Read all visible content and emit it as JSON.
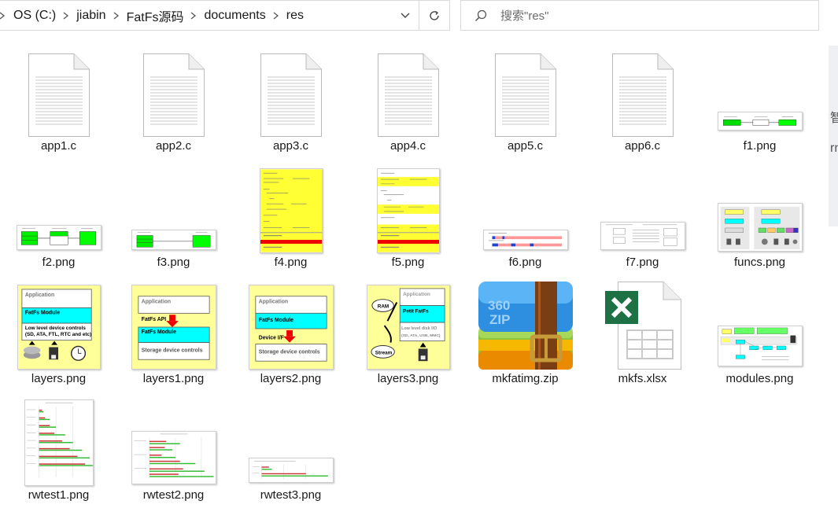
{
  "address": {
    "crumbs": [
      "OS (C:)",
      "jiabin",
      "FatFs源码",
      "documents",
      "res"
    ]
  },
  "search": {
    "placeholder": "搜索\"res\""
  },
  "files": [
    {
      "name": "app1.c",
      "kind": "c-file"
    },
    {
      "name": "app2.c",
      "kind": "c-file"
    },
    {
      "name": "app3.c",
      "kind": "c-file"
    },
    {
      "name": "app4.c",
      "kind": "c-file"
    },
    {
      "name": "app5.c",
      "kind": "c-file"
    },
    {
      "name": "app6.c",
      "kind": "c-file"
    },
    {
      "name": "f1.png",
      "kind": "png"
    },
    {
      "name": "f2.png",
      "kind": "png"
    },
    {
      "name": "f3.png",
      "kind": "png"
    },
    {
      "name": "f4.png",
      "kind": "png"
    },
    {
      "name": "f5.png",
      "kind": "png"
    },
    {
      "name": "f6.png",
      "kind": "png"
    },
    {
      "name": "f7.png",
      "kind": "png"
    },
    {
      "name": "funcs.png",
      "kind": "png"
    },
    {
      "name": "layers.png",
      "kind": "png"
    },
    {
      "name": "layers1.png",
      "kind": "png"
    },
    {
      "name": "layers2.png",
      "kind": "png"
    },
    {
      "name": "layers3.png",
      "kind": "png"
    },
    {
      "name": "mkfatimg.zip",
      "kind": "zip"
    },
    {
      "name": "mkfs.xlsx",
      "kind": "xlsx"
    },
    {
      "name": "modules.png",
      "kind": "png"
    },
    {
      "name": "rwtest1.png",
      "kind": "png"
    },
    {
      "name": "rwtest2.png",
      "kind": "png"
    },
    {
      "name": "rwtest3.png",
      "kind": "png"
    }
  ],
  "thumbs": {
    "layers": {
      "application": "Application",
      "module": "FatFs Module",
      "lowlevel": "Low level device controls",
      "lowlevel2": "(SD, ATA, FTL, RTC and etc)"
    },
    "layers1": {
      "application": "Application",
      "api": "FatFs API",
      "module": "FatFs Module",
      "storage": "Storage device controls"
    },
    "layers2": {
      "application": "Application",
      "module": "FatFs Module",
      "devif": "Device I/F",
      "storage": "Storage device controls"
    },
    "layers3": {
      "ram": "RAM",
      "stream": "Stream",
      "application": "Application",
      "module": "Petit FatFs",
      "lowlevel": "Low level disk I/O",
      "lowlevel2": "(SD, ATA, USB, MMC)"
    },
    "zip": {
      "brand": "360",
      "sub": "ZIP"
    }
  },
  "colors": {
    "accent_green": "#21a366",
    "excel_green": "#1e7145",
    "thumb_yellow": "#ffff99",
    "cyan": "#00ffff",
    "lime": "#00ff00",
    "red": "#ff0000"
  },
  "icons": {
    "refresh": "refresh-icon",
    "search": "search-icon",
    "dropdown": "chevron-down-icon",
    "separator": "chevron-right-icon"
  },
  "edge": {
    "g1": "智",
    "g2": "rn"
  }
}
